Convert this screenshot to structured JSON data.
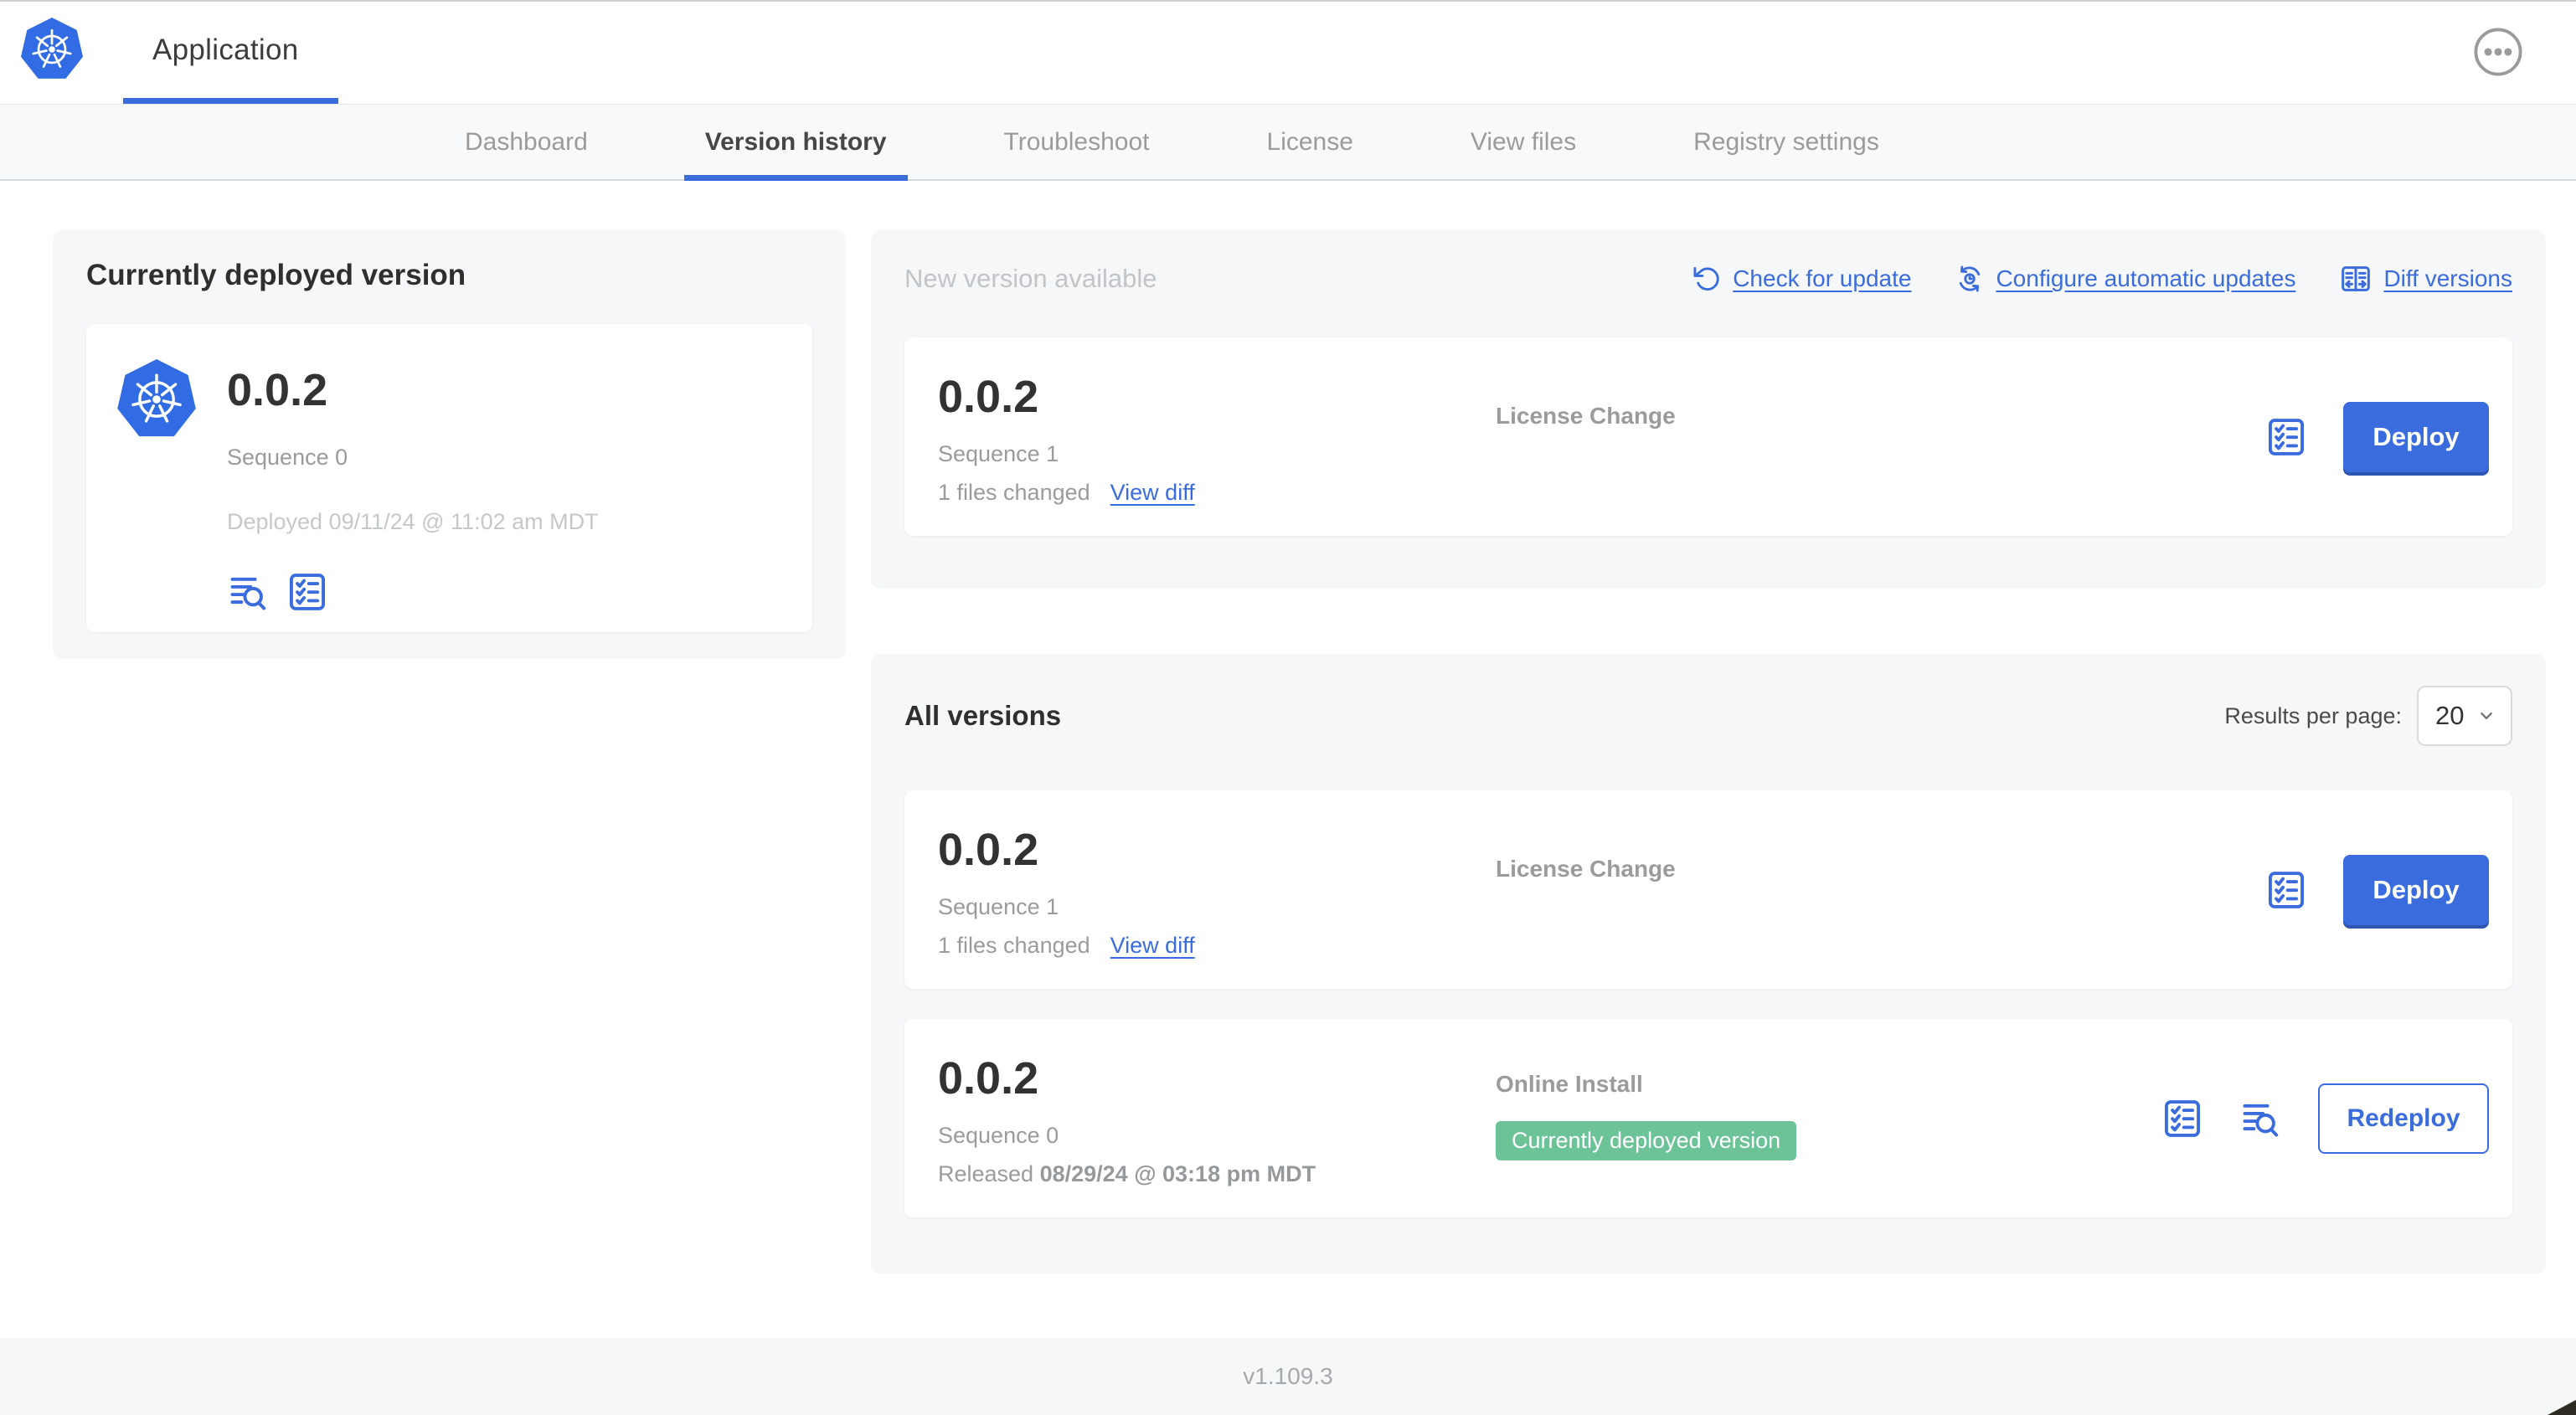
{
  "colors": {
    "accent": "#3B6CDE",
    "k8s_blue": "#326CE5",
    "badge_green": "#6CC398",
    "panel_bg": "#F5F7F8"
  },
  "header": {
    "title": "Application"
  },
  "nav": {
    "tabs": [
      {
        "label": "Dashboard",
        "active": false
      },
      {
        "label": "Version history",
        "active": true
      },
      {
        "label": "Troubleshoot",
        "active": false
      },
      {
        "label": "License",
        "active": false
      },
      {
        "label": "View files",
        "active": false
      },
      {
        "label": "Registry settings",
        "active": false
      }
    ]
  },
  "currentVersion": {
    "panel_title": "Currently deployed version",
    "version": "0.0.2",
    "sequence": "Sequence 0",
    "deployed": "Deployed 09/11/24 @ 11:02 am MDT"
  },
  "newVersion": {
    "panel_title": "New version available",
    "links": {
      "check_for_update": "Check for update",
      "configure_automatic_updates": "Configure automatic updates",
      "diff_versions": "Diff versions"
    },
    "card": {
      "version": "0.0.2",
      "sequence": "Sequence 1",
      "files_changed": "1 files changed",
      "view_diff": "View diff",
      "source": "License Change",
      "action": "Deploy"
    }
  },
  "allVersions": {
    "panel_title": "All versions",
    "results_per_page_label": "Results per page:",
    "results_per_page_value": "20",
    "rows": [
      {
        "version": "0.0.2",
        "sequence": "Sequence 1",
        "files_changed": "1 files changed",
        "view_diff": "View diff",
        "source": "License Change",
        "action": "Deploy"
      },
      {
        "version": "0.0.2",
        "sequence": "Sequence 0",
        "released_prefix": "Released ",
        "released_date": "08/29/24 @ 03:18 pm MDT",
        "source": "Online Install",
        "badge": "Currently deployed version",
        "action": "Redeploy"
      }
    ]
  },
  "footer": {
    "app_version": "v1.109.3"
  }
}
